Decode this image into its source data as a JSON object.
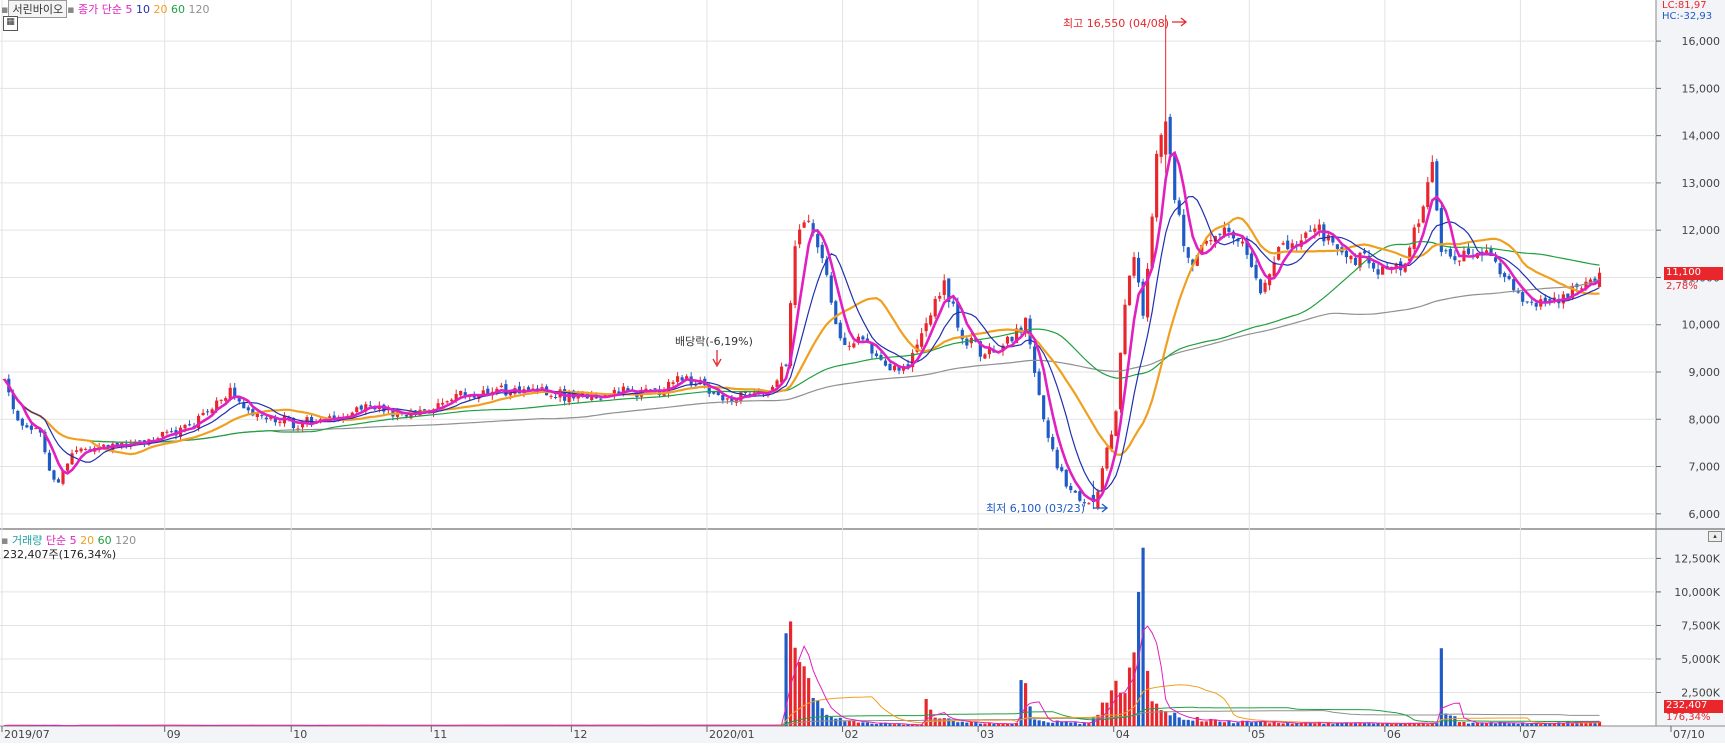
{
  "header": {
    "stock_name": "서린바이오",
    "price_ma_label": "종가 단순",
    "price_ma_periods": [
      "5",
      "10",
      "20",
      "60",
      "120"
    ],
    "volume_label": "거래량",
    "volume_ma_label": "단순",
    "volume_ma_periods": [
      "5",
      "20",
      "60",
      "120"
    ],
    "volume_value": "232,407주(176,34%)"
  },
  "indicators": {
    "lc": "LC:81,97",
    "hc": "HC:-32,93"
  },
  "current": {
    "price": "11,100",
    "change": "2,78%",
    "volume": "232,407",
    "volume_change": "176,34%"
  },
  "annotations": {
    "high": "최고 16,550 (04/08)",
    "low": "최저 6,100 (03/23)",
    "dividend": "배당락(-6,19%)"
  },
  "colors": {
    "up": "#e8262c",
    "down": "#1e5bc6",
    "ma5": "#e020c0",
    "ma10": "#2030b0",
    "ma20": "#f0a020",
    "ma60": "#20a040",
    "ma120": "#909090"
  },
  "chart_data": {
    "type": "candlestick",
    "price_axis": {
      "min": 5700,
      "max": 16700,
      "ticks": [
        "6,000",
        "7,000",
        "8,000",
        "9,000",
        "10,000",
        "11,000",
        "12,000",
        "13,000",
        "14,000",
        "15,000",
        "16,000"
      ],
      "tick_values": [
        6000,
        7000,
        8000,
        9000,
        10000,
        11000,
        12000,
        13000,
        14000,
        15000,
        16000
      ]
    },
    "volume_axis": {
      "max": 13500,
      "ticks": [
        "2,500K",
        "5,000K",
        "7,500K",
        "10,000K",
        "12,500K"
      ],
      "tick_values": [
        2500,
        5000,
        7500,
        10000,
        12500
      ]
    },
    "x_labels": [
      "2019/07",
      "09",
      "10",
      "11",
      "12",
      "2020/01",
      "02",
      "03",
      "04",
      "05",
      "06",
      "07",
      "07/10"
    ],
    "x_label_index": [
      0,
      36,
      64,
      95,
      126,
      156,
      186,
      216,
      246,
      276,
      306,
      336,
      366
    ],
    "price_keypoints": [
      [
        0,
        8800
      ],
      [
        3,
        8000
      ],
      [
        8,
        7700
      ],
      [
        10,
        6900
      ],
      [
        12,
        6700
      ],
      [
        15,
        7300
      ],
      [
        20,
        7400
      ],
      [
        30,
        7500
      ],
      [
        36,
        7700
      ],
      [
        42,
        7900
      ],
      [
        50,
        8600
      ],
      [
        55,
        8100
      ],
      [
        60,
        8000
      ],
      [
        64,
        7900
      ],
      [
        75,
        8100
      ],
      [
        80,
        8300
      ],
      [
        86,
        8100
      ],
      [
        95,
        8200
      ],
      [
        100,
        8500
      ],
      [
        110,
        8600
      ],
      [
        120,
        8550
      ],
      [
        126,
        8450
      ],
      [
        135,
        8550
      ],
      [
        145,
        8600
      ],
      [
        150,
        8900
      ],
      [
        155,
        8700
      ],
      [
        160,
        8400
      ],
      [
        170,
        8600
      ],
      [
        173,
        9200
      ],
      [
        175,
        11800
      ],
      [
        178,
        12300
      ],
      [
        181,
        11500
      ],
      [
        184,
        10000
      ],
      [
        186,
        9500
      ],
      [
        190,
        9700
      ],
      [
        195,
        9200
      ],
      [
        200,
        9100
      ],
      [
        205,
        10300
      ],
      [
        208,
        10800
      ],
      [
        212,
        9800
      ],
      [
        216,
        9400
      ],
      [
        222,
        9600
      ],
      [
        226,
        10000
      ],
      [
        230,
        8000
      ],
      [
        233,
        7000
      ],
      [
        236,
        6500
      ],
      [
        239,
        6200
      ],
      [
        241,
        6100
      ],
      [
        243,
        7000
      ],
      [
        246,
        8100
      ],
      [
        248,
        10500
      ],
      [
        250,
        11500
      ],
      [
        252,
        10200
      ],
      [
        254,
        12200
      ],
      [
        255,
        13500
      ],
      [
        257,
        14300
      ],
      [
        259,
        12800
      ],
      [
        262,
        11300
      ],
      [
        266,
        11700
      ],
      [
        270,
        12100
      ],
      [
        274,
        11700
      ],
      [
        278,
        10800
      ],
      [
        282,
        11500
      ],
      [
        287,
        11900
      ],
      [
        291,
        12000
      ],
      [
        295,
        11600
      ],
      [
        300,
        11400
      ],
      [
        305,
        11100
      ],
      [
        310,
        11300
      ],
      [
        314,
        12500
      ],
      [
        316,
        13500
      ],
      [
        318,
        11500
      ],
      [
        322,
        11400
      ],
      [
        326,
        11600
      ],
      [
        330,
        11300
      ],
      [
        334,
        10700
      ],
      [
        338,
        10400
      ],
      [
        345,
        10600
      ],
      [
        350,
        10800
      ],
      [
        353,
        11100
      ]
    ],
    "volume_keypoints": [
      [
        0,
        40
      ],
      [
        170,
        60
      ],
      [
        174,
        7800
      ],
      [
        176,
        7600
      ],
      [
        178,
        4500
      ],
      [
        180,
        1500
      ],
      [
        182,
        700
      ],
      [
        190,
        250
      ],
      [
        203,
        100
      ],
      [
        204,
        1700
      ],
      [
        206,
        700
      ],
      [
        210,
        350
      ],
      [
        224,
        200
      ],
      [
        225,
        3900
      ],
      [
        228,
        400
      ],
      [
        240,
        200
      ],
      [
        246,
        3200
      ],
      [
        248,
        2500
      ],
      [
        251,
        10000
      ],
      [
        252,
        13300
      ],
      [
        253,
        3500
      ],
      [
        256,
        1400
      ],
      [
        260,
        700
      ],
      [
        270,
        350
      ],
      [
        300,
        200
      ],
      [
        317,
        200
      ],
      [
        318,
        5800
      ],
      [
        319,
        1200
      ],
      [
        322,
        300
      ],
      [
        340,
        200
      ],
      [
        353,
        400
      ]
    ],
    "ma_periods": [
      5,
      10,
      20,
      60,
      120
    ],
    "volume_ma_periods": [
      5,
      20,
      60,
      120
    ]
  }
}
